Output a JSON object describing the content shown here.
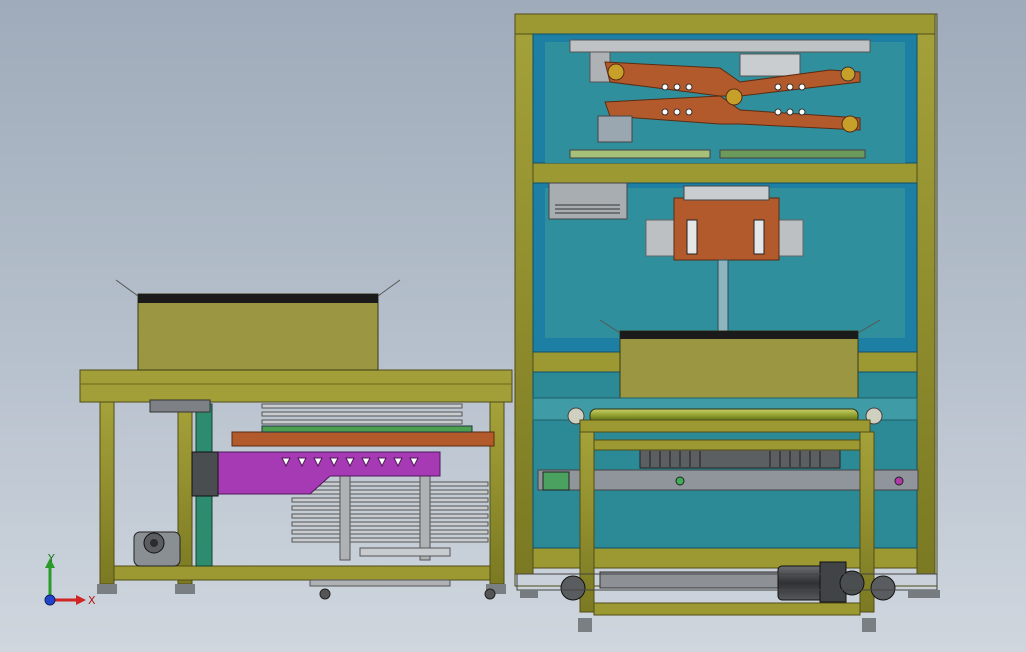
{
  "viewport": {
    "background_top": "#9fabba",
    "background_bottom": "#cfd6de"
  },
  "colors": {
    "frame_olive": "#8c8a2a",
    "frame_dark": "#54521a",
    "panel_teal": "#2e8c98",
    "panel_blue": "#1e7ea8",
    "rust_arm": "#b35a2c",
    "purple_carriage": "#a63ab5",
    "green_pipe": "#2d8b6e",
    "gray_metal": "#a9aeb3",
    "dark_motor": "#3b3d3f"
  },
  "triad": {
    "x_label": "X",
    "y_label": "Y",
    "icon": "coordinate-triad-icon"
  }
}
